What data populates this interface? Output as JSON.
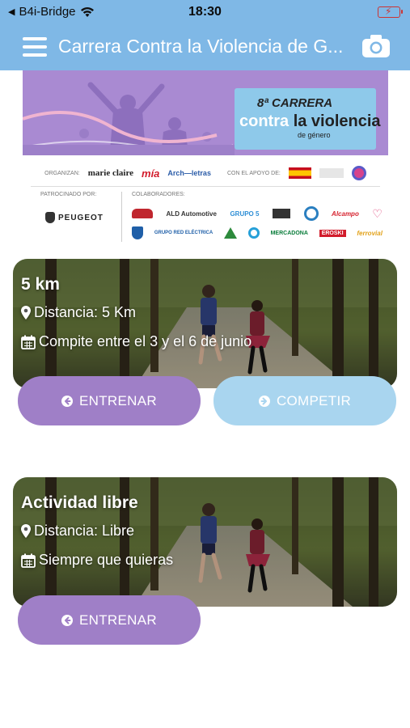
{
  "status_bar": {
    "back_label": "B4i-Bridge",
    "time": "18:30"
  },
  "header": {
    "title": "Carrera Contra la Violencia de G..."
  },
  "banner": {
    "race_line1": "8ª CARRERA",
    "race_line2_a": "contra",
    "race_line2_b": "la violencia",
    "race_line3": "de género",
    "organizan_label": "ORGANIZAN:",
    "org1": "marie claire",
    "org2": "mía",
    "org3": "Arch—letras",
    "apoyo_label": "CON EL APOYO DE:",
    "patrocinado_label": "PATROCINADO POR:",
    "sponsor": "PEUGEOT",
    "colaboradores_label": "COLABORADORES:",
    "collab1": "ALD Automotive",
    "collab2": "GRUPO 5",
    "collab3": "Alcampo",
    "collab4": "GRUPO RED ELÉCTRICA",
    "collab5": "MERCADONA",
    "collab6": "EROSKI",
    "collab7": "ferrovial"
  },
  "cards": [
    {
      "title": "5 km",
      "distance": "Distancia: 5 Km",
      "schedule": "Compite entre el 3 y el 6 de junio",
      "primary_button": "ENTRENAR",
      "secondary_button": "COMPETIR"
    },
    {
      "title": "Actividad libre",
      "distance": "Distancia: Libre",
      "schedule": "Siempre que quieras",
      "primary_button": "ENTRENAR"
    }
  ],
  "colors": {
    "header": "#7fb8e6",
    "purple_button": "#9f7fc7",
    "blue_button": "#a9d5ef",
    "banner_purple": "#a98ad2"
  }
}
